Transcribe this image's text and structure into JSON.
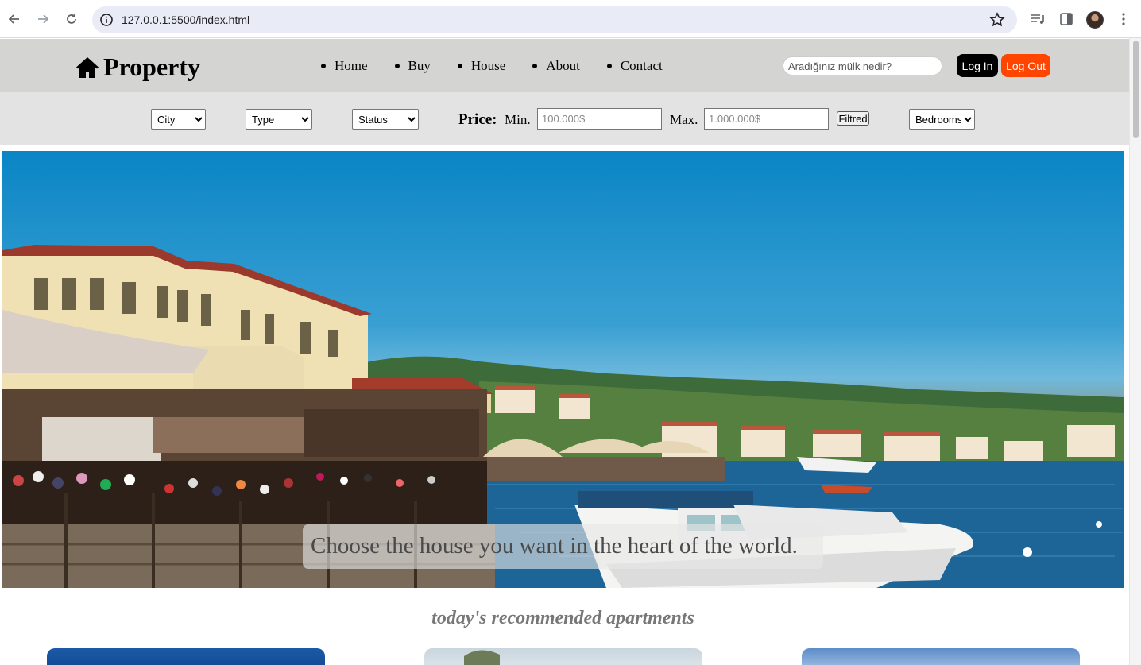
{
  "browser": {
    "url": "127.0.0.1:5500/index.html"
  },
  "header": {
    "logo_text": "Property",
    "nav": [
      "Home",
      "Buy",
      "House",
      "About",
      "Contact"
    ],
    "search_placeholder": "Aradığınız mülk nedir?",
    "login_label": "Log In",
    "logout_label": "Log Out",
    "logout_color": "#ff4500"
  },
  "filters": {
    "city": "City",
    "type": "Type",
    "status": "Status",
    "price_label": "Price:",
    "min_label": "Min.",
    "min_placeholder": "100.000$",
    "max_label": "Max.",
    "max_placeholder": "1.000.000$",
    "filter_button": "Filtred",
    "bedrooms": "Bedrooms"
  },
  "hero": {
    "caption": "Choose the house you want in the heart of the world."
  },
  "recommended": {
    "title": "today's recommended apartments"
  }
}
